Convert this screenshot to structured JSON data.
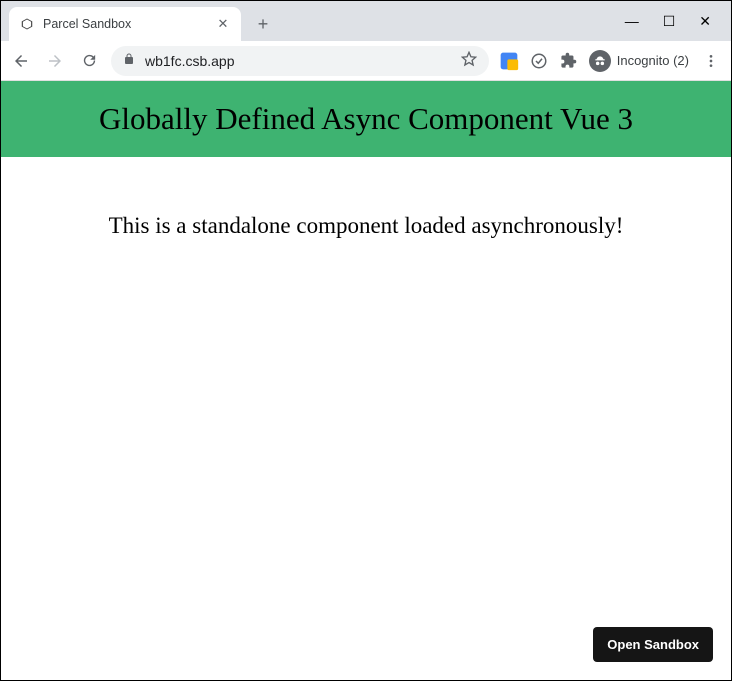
{
  "window": {
    "minimize": "—",
    "maximize": "☐",
    "close": "✕"
  },
  "tab": {
    "title": "Parcel Sandbox",
    "close": "✕"
  },
  "newtab": "+",
  "toolbar": {
    "url": "wb1fc.csb.app",
    "incognito_label": "Incognito (2)"
  },
  "page": {
    "heading": "Globally Defined Async Component Vue 3",
    "body": "This is a standalone component loaded asynchronously!"
  },
  "sandbox": {
    "button": "Open Sandbox"
  }
}
